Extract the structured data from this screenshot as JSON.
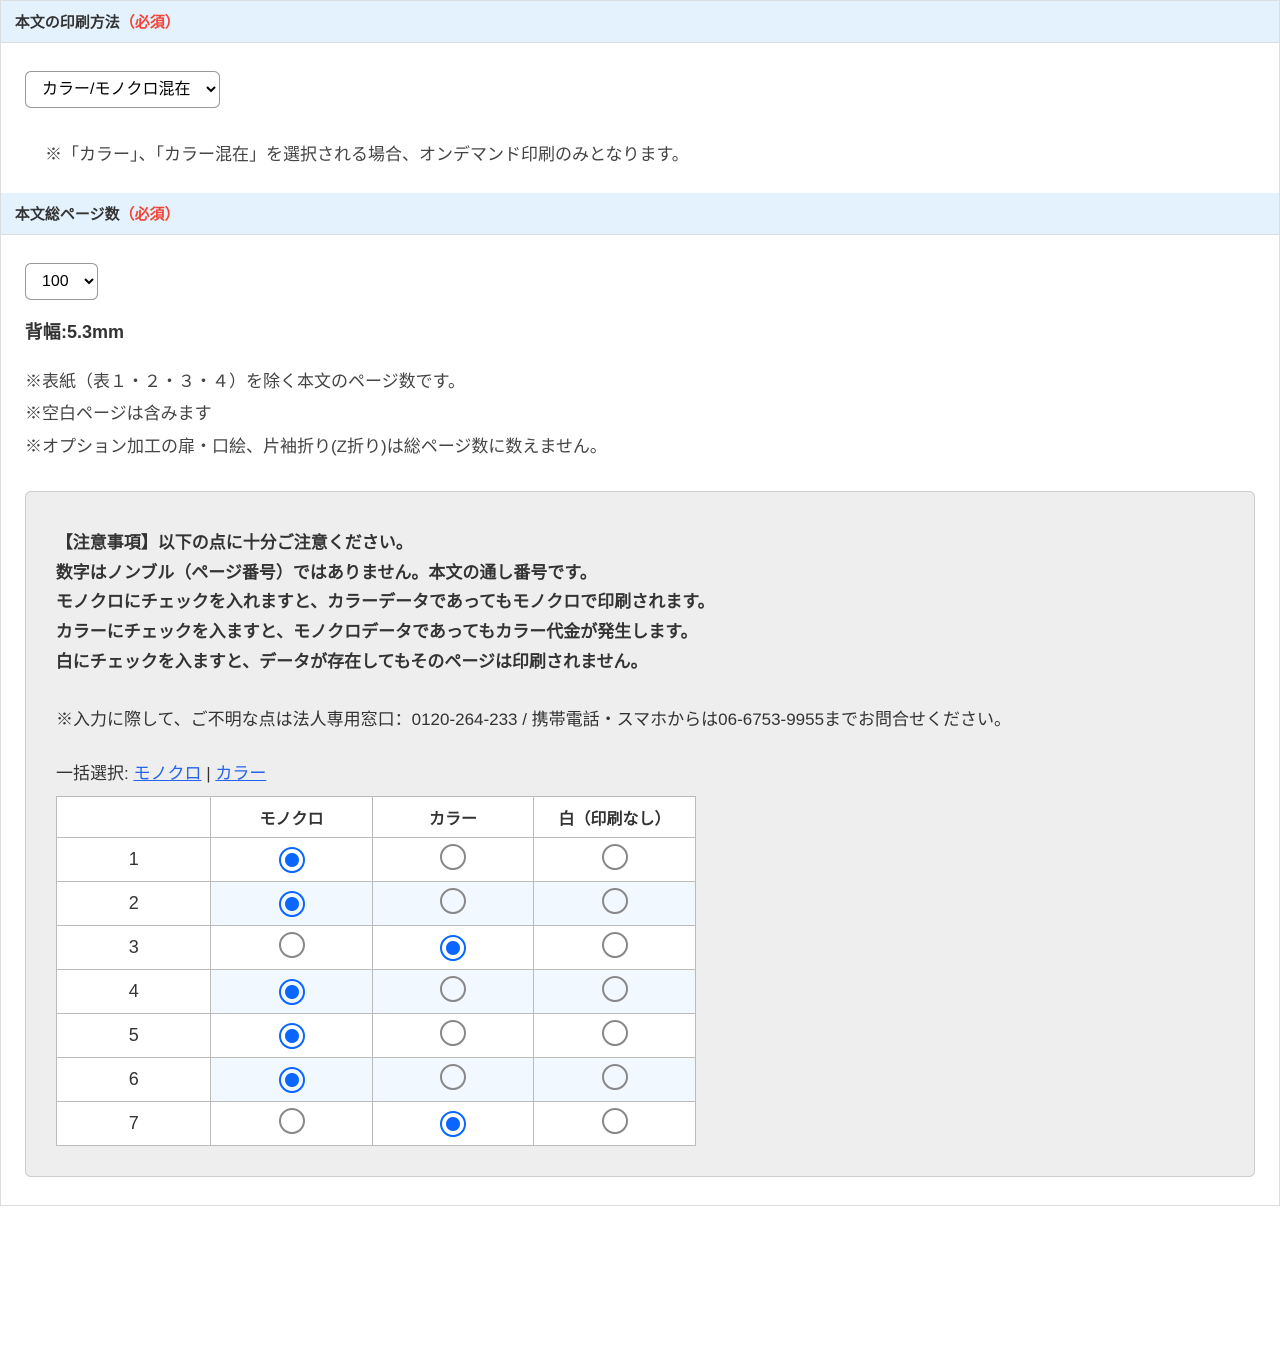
{
  "section1": {
    "title": "本文の印刷方法",
    "required": "（必須）",
    "select_value": "カラー/モノクロ混在",
    "note": "※「カラー」、「カラー混在」を選択される場合、オンデマンド印刷のみとなります。"
  },
  "section2": {
    "title": "本文総ページ数",
    "required": "（必須）",
    "page_count": "100",
    "spine_label": "背幅:",
    "spine_value": "5.3mm",
    "note1": "※表紙（表１・２・３・４）を除く本文のページ数です。",
    "note2": "※空白ページは含みます",
    "note3": "※オプション加工の扉・口絵、片袖折り(Z折り)は総ページ数に数えません。",
    "caution_heading": "【注意事項】以下の点に十分ご注意ください。",
    "caution_line1": "数字はノンブル（ページ番号）ではありません。本文の通し番号です。",
    "caution_line2": "モノクロにチェックを入れますと、カラーデータであってもモノクロで印刷されます。",
    "caution_line3": "カラーにチェックを入ますと、モノクロデータであってもカラー代金が発生します。",
    "caution_line4": "白にチェックを入ますと、データが存在してもそのページは印刷されません。",
    "contact_note": "※入力に際して、ご不明な点は法人専用窓口：0120-264-233 / 携帯電話・スマホからは06-6753-9955までお問合せください。",
    "bulk_label": "一括選択:",
    "bulk_mono": "モノクロ",
    "bulk_sep": " | ",
    "bulk_color": "カラー",
    "table": {
      "header_page": "",
      "header_mono": "モノクロ",
      "header_color": "カラー",
      "header_white": "白（印刷なし）",
      "rows": [
        {
          "page": "1",
          "selected": "mono"
        },
        {
          "page": "2",
          "selected": "mono"
        },
        {
          "page": "3",
          "selected": "color"
        },
        {
          "page": "4",
          "selected": "mono"
        },
        {
          "page": "5",
          "selected": "mono"
        },
        {
          "page": "6",
          "selected": "mono"
        },
        {
          "page": "7",
          "selected": "color"
        }
      ]
    }
  }
}
